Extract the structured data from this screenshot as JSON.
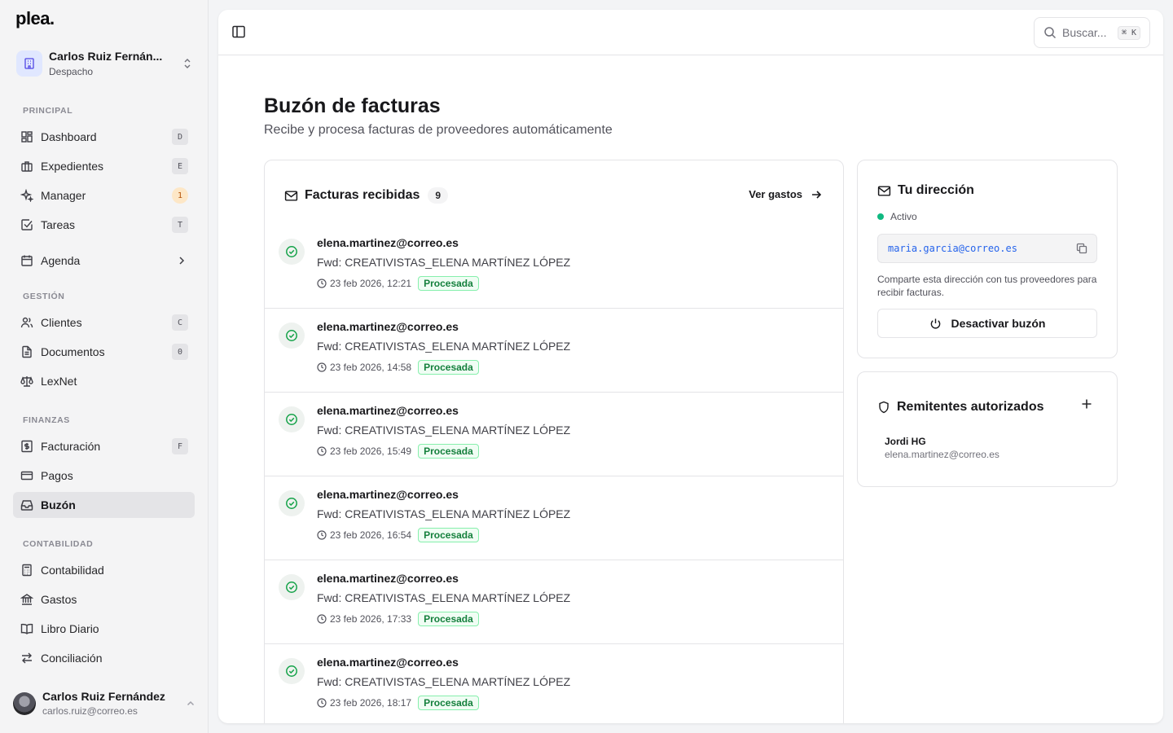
{
  "app": {
    "logo": "plea."
  },
  "workspace": {
    "name": "Carlos Ruiz Fernán...",
    "role": "Despacho"
  },
  "sidebar": {
    "sections": {
      "principal": "PRINCIPAL",
      "gestion": "GESTIÓN",
      "finanzas": "FINANZAS",
      "contabilidad": "CONTABILIDAD"
    },
    "items": [
      {
        "label": "Dashboard",
        "key": "D",
        "icon": "dashboard-icon"
      },
      {
        "label": "Expedientes",
        "key": "E",
        "icon": "briefcase-icon"
      },
      {
        "label": "Manager",
        "key": "1",
        "icon": "sparkles-icon"
      },
      {
        "label": "Tareas",
        "key": "T",
        "icon": "checkbox-icon"
      },
      {
        "label": "Agenda",
        "key": "",
        "icon": "calendar-icon"
      },
      {
        "label": "Clientes",
        "key": "C",
        "icon": "users-icon"
      },
      {
        "label": "Documentos",
        "key": "0",
        "icon": "document-icon"
      },
      {
        "label": "LexNet",
        "key": "",
        "icon": "scale-icon"
      },
      {
        "label": "Facturación",
        "key": "F",
        "icon": "dollar-icon"
      },
      {
        "label": "Pagos",
        "key": "",
        "icon": "credit-card-icon"
      },
      {
        "label": "Buzón",
        "key": "",
        "icon": "inbox-icon",
        "active": true
      },
      {
        "label": "Contabilidad",
        "key": "",
        "icon": "calculator-icon"
      },
      {
        "label": "Gastos",
        "key": "",
        "icon": "bank-icon"
      },
      {
        "label": "Libro Diario",
        "key": "",
        "icon": "book-icon"
      },
      {
        "label": "Conciliación",
        "key": "",
        "icon": "arrows-icon"
      }
    ]
  },
  "user": {
    "name": "Carlos Ruiz Fernández",
    "email": "carlos.ruiz@correo.es"
  },
  "topbar": {
    "search_placeholder": "Buscar...",
    "search_shortcut": "⌘ K"
  },
  "page": {
    "title": "Buzón de facturas",
    "subtitle": "Recibe y procesa facturas de proveedores automáticamente"
  },
  "invoices": {
    "title": "Facturas recibidas",
    "count": "9",
    "link_label": "Ver gastos",
    "rows": [
      {
        "from": "elena.martinez@correo.es",
        "subject": "Fwd: CREATIVISTAS_ELENA MARTÍNEZ LÓPEZ",
        "date": "23 feb 2026, 12:21",
        "status": "Procesada"
      },
      {
        "from": "elena.martinez@correo.es",
        "subject": "Fwd: CREATIVISTAS_ELENA MARTÍNEZ LÓPEZ",
        "date": "23 feb 2026, 14:58",
        "status": "Procesada"
      },
      {
        "from": "elena.martinez@correo.es",
        "subject": "Fwd: CREATIVISTAS_ELENA MARTÍNEZ LÓPEZ",
        "date": "23 feb 2026, 15:49",
        "status": "Procesada"
      },
      {
        "from": "elena.martinez@correo.es",
        "subject": "Fwd: CREATIVISTAS_ELENA MARTÍNEZ LÓPEZ",
        "date": "23 feb 2026, 16:54",
        "status": "Procesada"
      },
      {
        "from": "elena.martinez@correo.es",
        "subject": "Fwd: CREATIVISTAS_ELENA MARTÍNEZ LÓPEZ",
        "date": "23 feb 2026, 17:33",
        "status": "Procesada"
      },
      {
        "from": "elena.martinez@correo.es",
        "subject": "Fwd: CREATIVISTAS_ELENA MARTÍNEZ LÓPEZ",
        "date": "23 feb 2026, 18:17",
        "status": "Procesada"
      }
    ]
  },
  "address_card": {
    "title": "Tu dirección",
    "status": "Activo",
    "address": "maria.garcia@correo.es",
    "hint": "Comparte esta dirección con tus proveedores para recibir facturas.",
    "deactivate_label": "Desactivar buzón"
  },
  "senders_card": {
    "title": "Remitentes autorizados",
    "senders": [
      {
        "name": "Jordi HG",
        "email": "elena.martinez@correo.es"
      }
    ]
  },
  "colors": {
    "accent_green": "#10b981",
    "badge_green": "#15803d",
    "link_blue": "#2563eb",
    "warn_badge": "#b45309"
  }
}
